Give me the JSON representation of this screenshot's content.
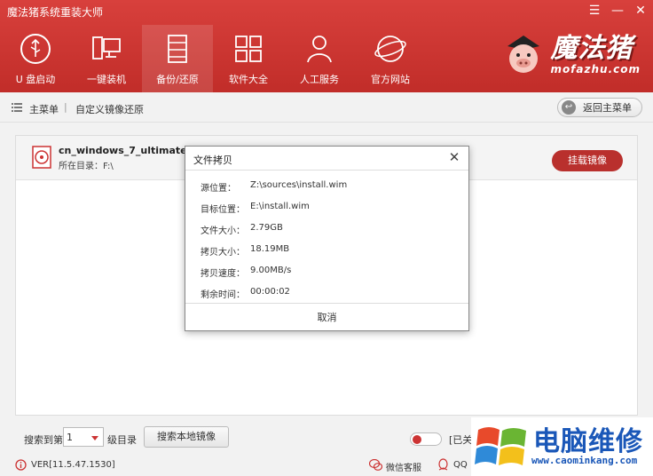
{
  "app": {
    "title": "魔法猪系统重装大师",
    "brand_cn": "魔法猪",
    "brand_en": "mofazhu.com"
  },
  "nav": {
    "items": [
      {
        "label": "U 盘启动",
        "icon": "usb-icon"
      },
      {
        "label": "一键装机",
        "icon": "computer-icon"
      },
      {
        "label": "备份/还原",
        "icon": "backup-icon",
        "active": true
      },
      {
        "label": "软件大全",
        "icon": "grid-icon"
      },
      {
        "label": "人工服务",
        "icon": "person-icon"
      },
      {
        "label": "官方网站",
        "icon": "globe-icon"
      }
    ]
  },
  "breadcrumb": {
    "main": "主菜单",
    "separator": "|",
    "current": "自定义镜像还原",
    "back_label": "返回主菜单"
  },
  "image": {
    "name": "cn_windows_7_ultimate_with_",
    "dir_label": "所在目录：F:\\"
  },
  "mount_label": "挂载镜像",
  "search": {
    "label1": "搜索到第",
    "level_value": "1",
    "label2": "级目录",
    "button": "搜索本地镜像",
    "toggle_label": "[已关"
  },
  "status": {
    "version": "VER[11.5.47.1530]",
    "wechat": "微信客服",
    "qq": "QQ"
  },
  "watermark": {
    "cn": "电脑维修",
    "url": "www.caominkang.com"
  },
  "dialog": {
    "title": "文件拷贝",
    "rows": [
      {
        "key": "源位置：",
        "value": "Z:\\sources\\install.wim"
      },
      {
        "key": "目标位置：",
        "value": "E:\\install.wim"
      },
      {
        "key": "文件大小：",
        "value": "2.79GB"
      },
      {
        "key": "拷贝大小：",
        "value": "18.19MB"
      },
      {
        "key": "拷贝速度：",
        "value": "9.00MB/s"
      },
      {
        "key": "剩余时间：",
        "value": "00:00:02"
      }
    ],
    "cancel": "取消"
  },
  "colors": {
    "header_red": "#c9332f",
    "accent_red": "#b9302d",
    "watermark_blue": "#1a57b8"
  }
}
